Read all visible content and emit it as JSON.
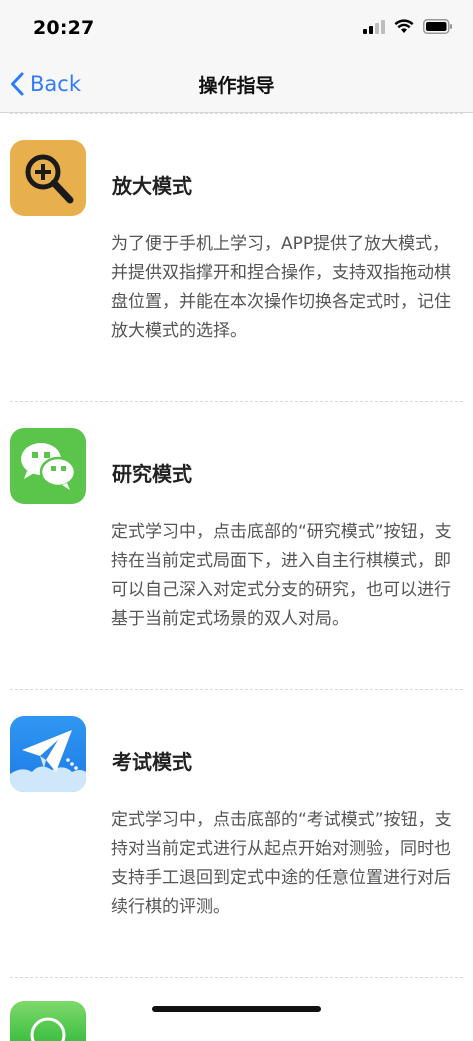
{
  "status_bar": {
    "time": "20:27"
  },
  "nav": {
    "back_label": "Back",
    "title": "操作指导"
  },
  "sections": [
    {
      "icon": "magnifier-icon",
      "icon_color": "#e8b04c",
      "title": "放大模式",
      "description": "为了便于手机上学习，APP提供了放大模式，并提供双指撑开和捏合操作，支持双指拖动棋盘位置，并能在本次操作切换各定式时，记住放大模式的选择。"
    },
    {
      "icon": "wechat-icon",
      "icon_color": "#5ac54a",
      "title": "研究模式",
      "description": "定式学习中，点击底部的“研究模式”按钮，支持在当前定式局面下，进入自主行棋模式，即可以自己深入对定式分支的研究，也可以进行基于当前定式场景的双人对局。"
    },
    {
      "icon": "paper-plane-icon",
      "icon_color": "#2d8df0",
      "title": "考试模式",
      "description": "定式学习中，点击底部的“考试模式”按钮，支持对当前定式进行从起点开始对测验，同时也支持手工退回到定式中途的任意位置进行对后续行棋的评测。"
    }
  ]
}
